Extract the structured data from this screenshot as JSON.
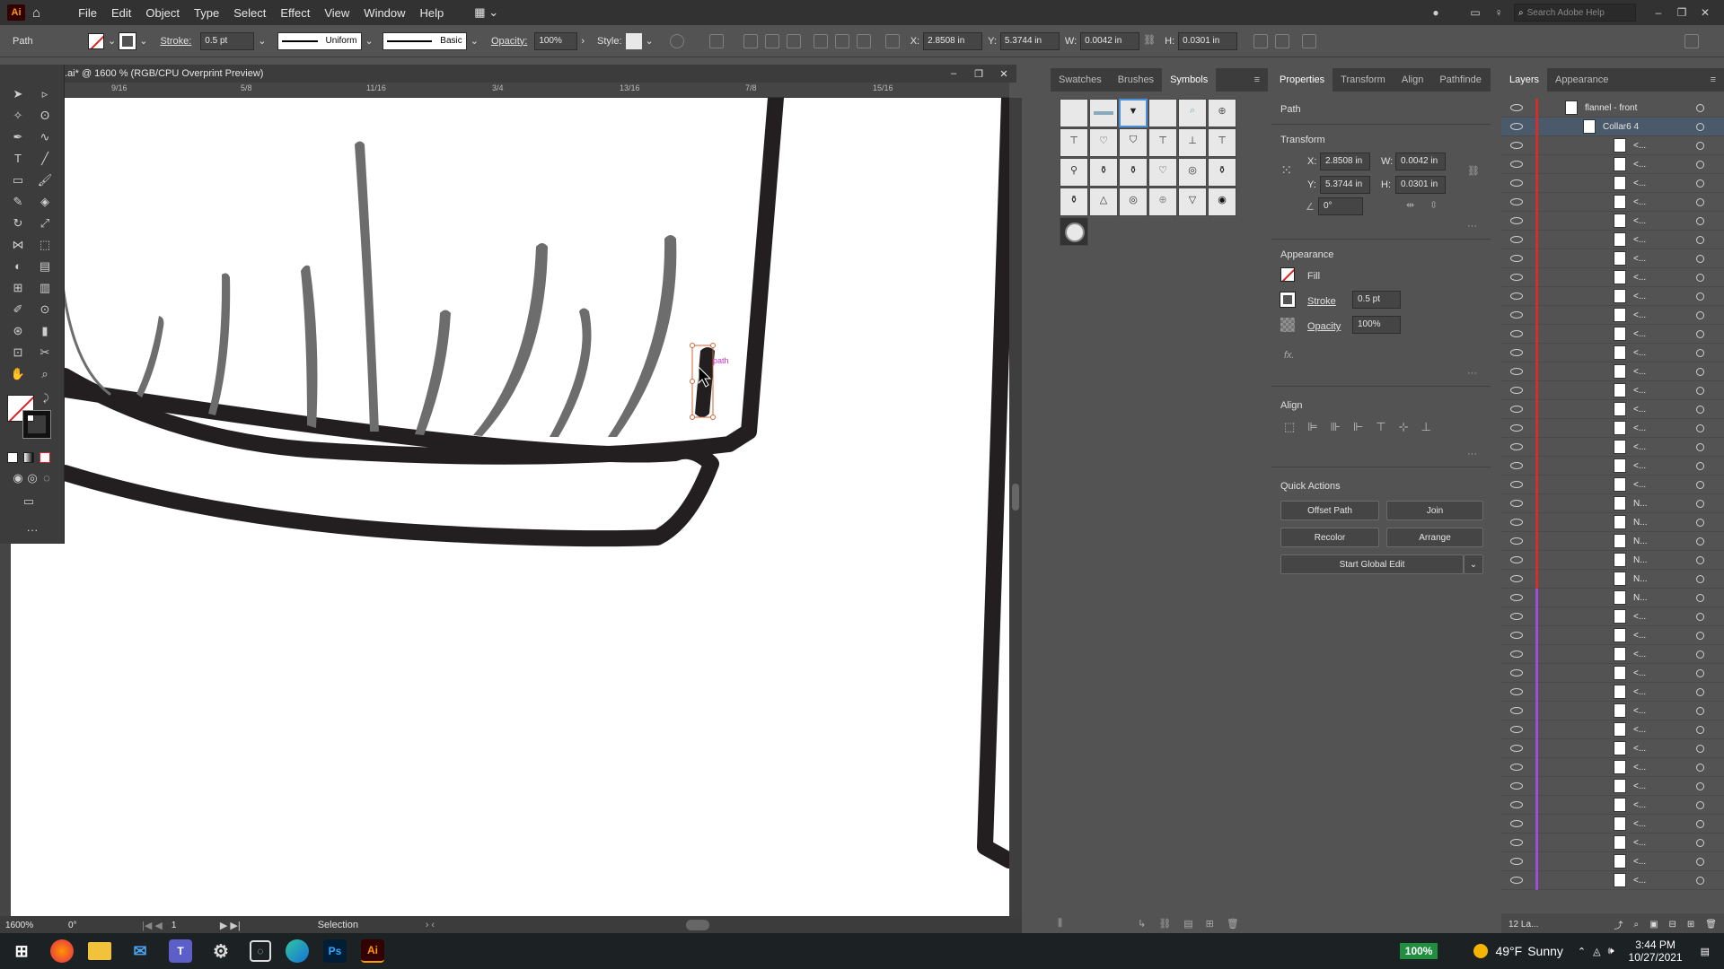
{
  "app": {
    "logo": "Ai",
    "accent": "#ff9a00"
  },
  "menu": [
    "File",
    "Edit",
    "Object",
    "Type",
    "Select",
    "Effect",
    "View",
    "Window",
    "Help"
  ],
  "search": {
    "placeholder": "Search Adobe Help"
  },
  "control": {
    "object_type": "Path",
    "stroke_label": "Stroke:",
    "stroke_value": "0.5 pt",
    "profile": "Uniform",
    "brush": "Basic",
    "opacity_label": "Opacity:",
    "opacity_value": "100%",
    "style_label": "Style:",
    "x_label": "X:",
    "x_value": "2.8508 in",
    "y_label": "Y:",
    "y_value": "5.3744 in",
    "w_label": "W:",
    "w_value": "0.0042 in",
    "h_label": "H:",
    "h_value": "0.0301 in"
  },
  "document": {
    "tab_title": ".ai* @ 1600 % (RGB/CPU Overprint Preview)"
  },
  "ruler_ticks": [
    "9/16",
    "5/8",
    "11/16",
    "3/4",
    "13/16",
    "7/8",
    "15/16"
  ],
  "canvas": {
    "hover_label": "path",
    "ink": "#231f20",
    "hair": "#6d6d6d",
    "highlight": "#cc33cc"
  },
  "status": {
    "zoom": "1600%",
    "angle": "0°",
    "artboard": "1",
    "tool": "Selection"
  },
  "symbols_panel": {
    "tabs": [
      "Swatches",
      "Brushes",
      "Symbols"
    ],
    "active": "Symbols"
  },
  "props_panel": {
    "tabs": [
      "Properties",
      "Transform",
      "Align",
      "Pathfinde"
    ],
    "selection": "Path",
    "transform_title": "Transform",
    "x_label": "X:",
    "x": "2.8508 in",
    "y_label": "Y:",
    "y": "5.3744 in",
    "w_label": "W:",
    "w": "0.0042 in",
    "h_label": "H:",
    "h": "0.0301 in",
    "angle": "0°",
    "appearance_title": "Appearance",
    "fill": "Fill",
    "stroke": "Stroke",
    "stroke_value": "0.5 pt",
    "opacity": "Opacity",
    "opacity_value": "100%",
    "fx": "fx.",
    "align_title": "Align",
    "quick_title": "Quick Actions",
    "btn_offset": "Offset Path",
    "btn_join": "Join",
    "btn_recolor": "Recolor",
    "btn_arrange": "Arrange",
    "btn_global": "Start Global Edit"
  },
  "layers_panel": {
    "tabs": [
      "Layers",
      "Appearance"
    ],
    "top_layer": "flannel - front",
    "sublayer": "Collar6 4",
    "rows": [
      "<...",
      "<...",
      "<...",
      "<...",
      "<...",
      "<...",
      "<...",
      "<...",
      "<...",
      "<...",
      "<...",
      "<...",
      "<...",
      "<...",
      "<...",
      "<...",
      "<...",
      "<...",
      "<...",
      "N...",
      "N...",
      "N...",
      "N...",
      "N...",
      "N...",
      "<...",
      "<...",
      "<...",
      "<...",
      "<...",
      "<...",
      "<...",
      "<...",
      "<...",
      "<...",
      "<...",
      "<...",
      "<...",
      "<...",
      "<..."
    ],
    "count": "12 La..."
  },
  "taskbar": {
    "battery": "100%",
    "weather_temp": "49°F",
    "weather_cond": "Sunny",
    "time": "3:44 PM",
    "date": "10/27/2021"
  }
}
